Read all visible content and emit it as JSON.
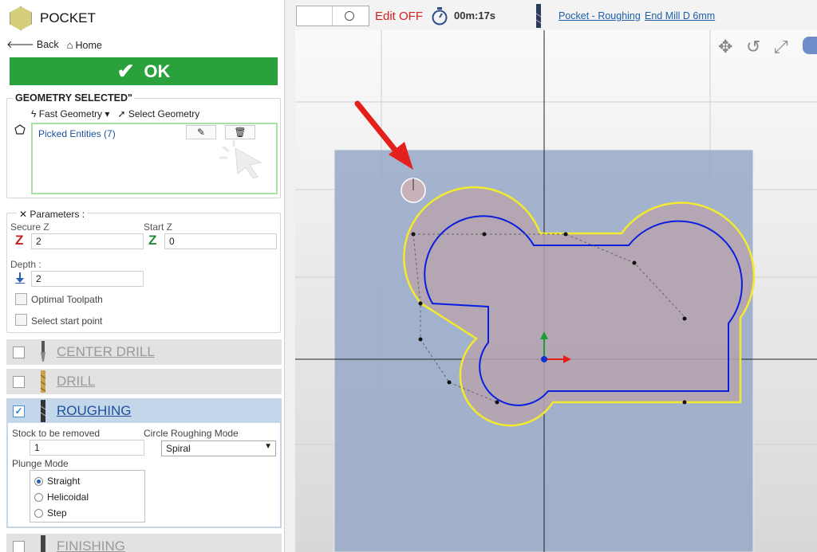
{
  "header": {
    "title": "POCKET",
    "back": "Back",
    "home": "Home",
    "ok": "OK"
  },
  "geometry": {
    "title": "GEOMETRY SELECTED\"",
    "fast_geometry": "Fast Geometry",
    "select_geometry": "Select Geometry",
    "picked": "Picked Entities (7)"
  },
  "parameters": {
    "title": "Parameters :",
    "secure_z_label": "Secure Z",
    "secure_z": "2",
    "start_z_label": "Start Z",
    "start_z": "0",
    "depth_label": "Depth :",
    "depth": "2",
    "optimal": "Optimal Toolpath",
    "start_point": "Select start point"
  },
  "tools": [
    {
      "name": "CENTER DRILL",
      "checked": false
    },
    {
      "name": "DRILL",
      "checked": false
    },
    {
      "name": "ROUGHING",
      "checked": true
    },
    {
      "name": "FINISHING",
      "checked": false
    }
  ],
  "roughing": {
    "stock_label": "Stock to be removed",
    "stock": "1",
    "circle_label": "Circle Roughing Mode",
    "circle_value": "Spiral",
    "plunge_label": "Plunge Mode",
    "plunge_options": [
      "Straight",
      "Helicoidal",
      "Step"
    ],
    "plunge_selected": "Straight"
  },
  "topbar": {
    "edit": "Edit OFF",
    "time": "00m:17s",
    "op_link": "Pocket - Roughing",
    "tool_link": "End Mill D 6mm"
  },
  "colors": {
    "ok_green": "#2aa13a",
    "edit_red": "#d42020",
    "link_blue": "#1d5fa8",
    "profile_yellow": "#f2ea2e",
    "toolpath_blue": "#0a1ee0",
    "arrow_red": "#e3201b"
  }
}
